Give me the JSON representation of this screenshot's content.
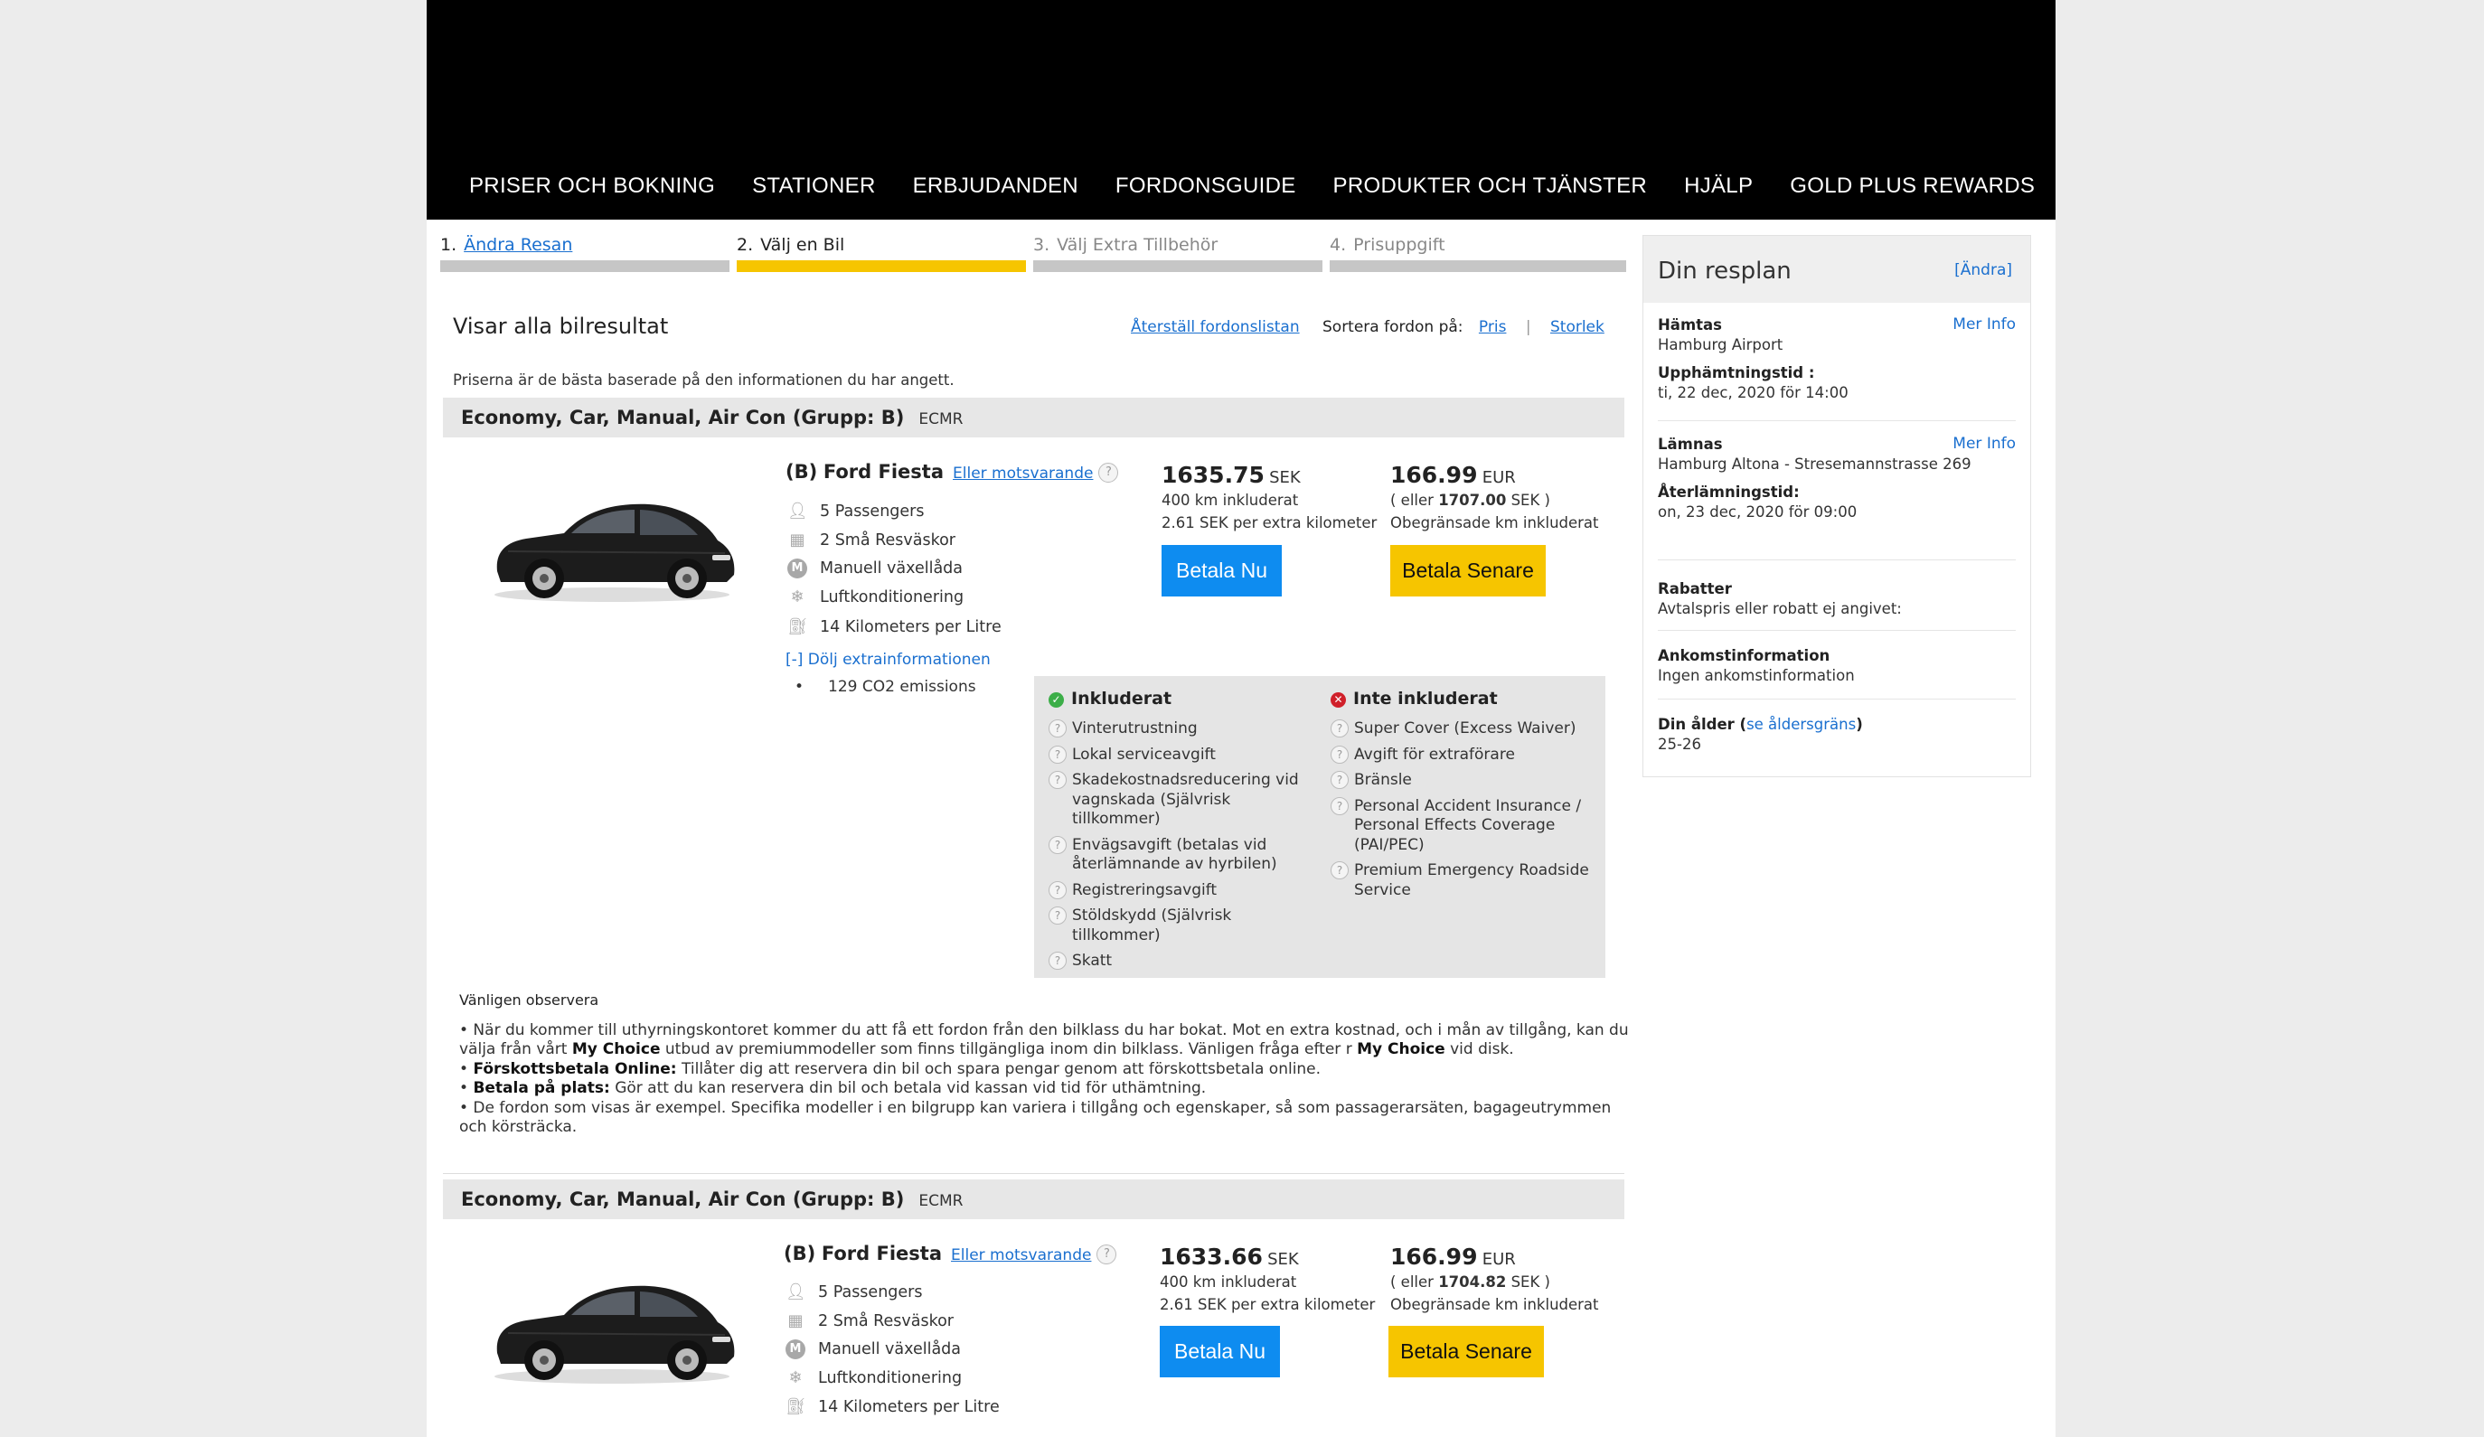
{
  "nav": [
    "PRISER OCH BOKNING",
    "STATIONER",
    "ERBJUDANDEN",
    "FORDONSGUIDE",
    "PRODUKTER OCH TJÄNSTER",
    "HJÄLP",
    "GOLD PLUS REWARDS"
  ],
  "steps": [
    {
      "num": "1.",
      "label": "Ändra Resan"
    },
    {
      "num": "2.",
      "label": "Välj en Bil"
    },
    {
      "num": "3.",
      "label": "Välj Extra Tillbehör"
    },
    {
      "num": "4.",
      "label": "Prisuppgift"
    }
  ],
  "results": {
    "title": "Visar alla bilresultat",
    "reset": "Återställ fordonslistan",
    "sort_label": "Sortera fordon på:",
    "sort_price": "Pris",
    "sort_sep": "|",
    "sort_size": "Storlek",
    "note": "Priserna är de bästa baserade på den informationen du har angett."
  },
  "cars": [
    {
      "group": "Economy, Car, Manual, Air Con (Grupp: B)",
      "code": "ECMR",
      "name_prefix": "(B)",
      "name": "Ford Fiesta",
      "similar": "Eller motsvarande",
      "features": [
        "5 Passengers",
        "2 Små Resväskor",
        "Manuell växellåda",
        "Luftkonditionering",
        "14 Kilometers per Litre"
      ],
      "pay_now": {
        "amount": "1635.75",
        "currency": "SEK",
        "line1": "400 km inkluderat",
        "line2": "2.61 SEK per extra kilometer",
        "button": "Betala Nu"
      },
      "pay_later": {
        "amount": "166.99",
        "currency": "EUR",
        "line1_pre": "( eller ",
        "line1_amount": "1707.00",
        "line1_post": " SEK )",
        "line2": "Obegränsade km inkluderat",
        "button": "Betala Senare"
      }
    },
    {
      "group": "Economy, Car, Manual, Air Con (Grupp: B)",
      "code": "ECMR",
      "name_prefix": "(B)",
      "name": "Ford Fiesta",
      "similar": "Eller motsvarande",
      "features": [
        "5 Passengers",
        "2 Små Resväskor",
        "Manuell växellåda",
        "Luftkonditionering",
        "14 Kilometers per Litre"
      ],
      "pay_now": {
        "amount": "1633.66",
        "currency": "SEK",
        "line1": "400 km inkluderat",
        "line2": "2.61 SEK per extra kilometer",
        "button": "Betala Nu"
      },
      "pay_later": {
        "amount": "166.99",
        "currency": "EUR",
        "line1_pre": "( eller ",
        "line1_amount": "1704.82",
        "line1_post": " SEK )",
        "line2": "Obegränsade km inkluderat",
        "button": "Betala Senare"
      }
    }
  ],
  "extra": {
    "toggle": "[-] Dölj extrainformationen",
    "emissions": "129 CO2 emissions"
  },
  "included": {
    "title": "Inkluderat",
    "items": [
      "Vinterutrustning",
      "Lokal serviceavgift",
      "Skadekostnadsreducering vid vagnskada (Självrisk tillkommer)",
      "Envägsavgift (betalas vid återlämnande av hyrbilen)",
      "Registreringsavgift",
      "Stöldskydd (Självrisk tillkommer)",
      "Skatt"
    ]
  },
  "not_included": {
    "title": "Inte inkluderat",
    "items": [
      "Super Cover (Excess Waiver)",
      "Avgift för extraförare",
      "Bränsle",
      "Personal Accident Insurance / Personal Effects Coverage (PAI/PEC)",
      "Premium Emergency Roadside Service"
    ]
  },
  "observe": {
    "title": "Vänligen observera",
    "p1_a": "• När du kommer till uthyrningskontoret kommer du att få ett fordon från den bilklass du har bokat. Mot en extra kostnad, och i mån av tillgång, kan du välja från vårt ",
    "p1_b": "My Choice",
    "p1_c": " utbud av premiummodeller som finns tillgängliga inom din bilklass. Vänligen fråga efter r ",
    "p1_d": "My Choice",
    "p1_e": " vid disk.",
    "p2_b": "Förskottsbetala Online:",
    "p2_t": " Tillåter dig att reservera din bil och spara pengar genom att förskottsbetala online.",
    "p3_b": "Betala på plats:",
    "p3_t": " Gör att du kan reservera din bil och betala vid kassan vid tid för uthämtning.",
    "p4": "• De fordon som visas är exempel. Specifika modeller i en bilgrupp kan variera i tillgång och egenskaper, så som passagerarsäten, bagageutrymmen och körsträcka."
  },
  "sidebar": {
    "title": "Din resplan",
    "change": "[Ändra]",
    "more_info": "Mer Info",
    "pickup_label": "Hämtas",
    "pickup_loc": "Hamburg Airport",
    "pickup_time_label": "Upphämtningstid :",
    "pickup_time": "ti, 22 dec, 2020 för 14:00",
    "return_label": "Lämnas",
    "return_loc": "Hamburg Altona - Stresemannstrasse 269",
    "return_time_label": "Återlämningstid:",
    "return_time": "on, 23 dec, 2020 för 09:00",
    "discount_label": "Rabatter",
    "discount_val": "Avtalspris eller robatt ej angivet:",
    "arrival_label": "Ankomstinformation",
    "arrival_val": "Ingen ankomstinformation",
    "age_label_a": "Din ålder (",
    "age_link": "se åldersgräns",
    "age_label_b": ")",
    "age_val": "25-26"
  }
}
